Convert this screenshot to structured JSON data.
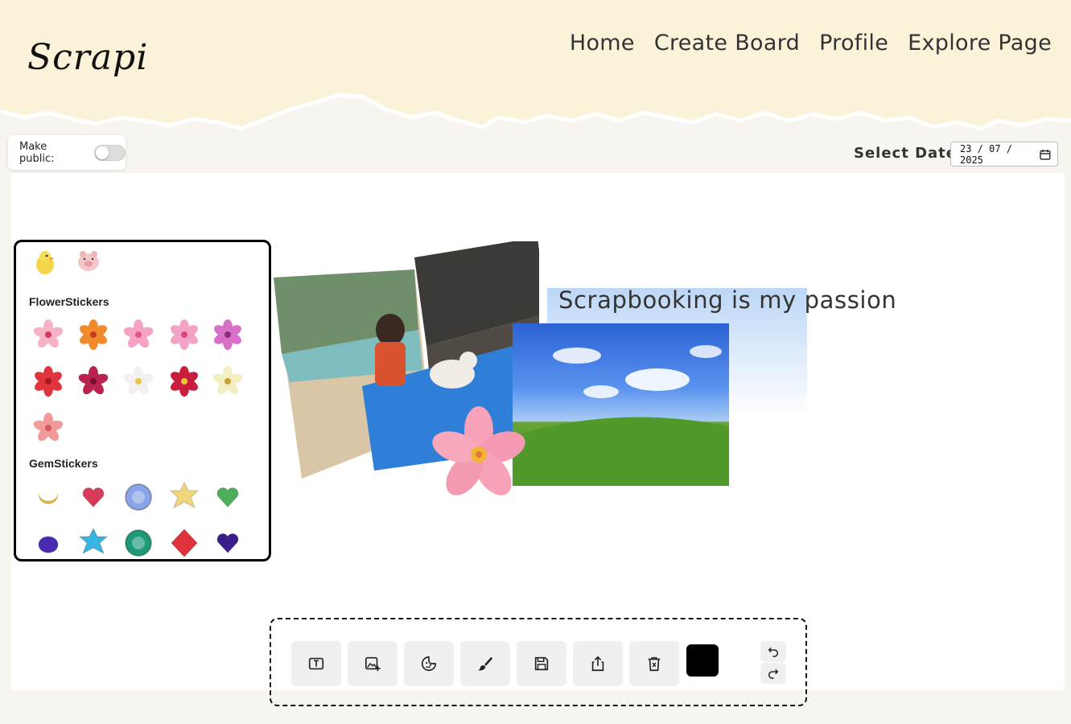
{
  "app": {
    "logo": "Scrapi"
  },
  "nav": {
    "items": [
      "Home",
      "Create Board",
      "Profile",
      "Explore Page"
    ]
  },
  "board": {
    "make_public_label": "Make public:",
    "make_public_on": false,
    "select_date_label": "Select Date:",
    "date_value": "23 / 07 / 2025",
    "caption": "Scrapbooking is my passion"
  },
  "sticker_panel": {
    "categories": [
      "FlowerStickers",
      "GemStickers"
    ]
  },
  "toolbar": {
    "current_color": "#000000",
    "buttons": [
      "text-tool-icon",
      "add-image-icon",
      "sticker-icon",
      "brush-icon",
      "save-icon",
      "share-icon",
      "delete-icon"
    ]
  },
  "colors": {
    "header_bg": "#faf3d9",
    "page_bg": "#f8f4ef"
  }
}
